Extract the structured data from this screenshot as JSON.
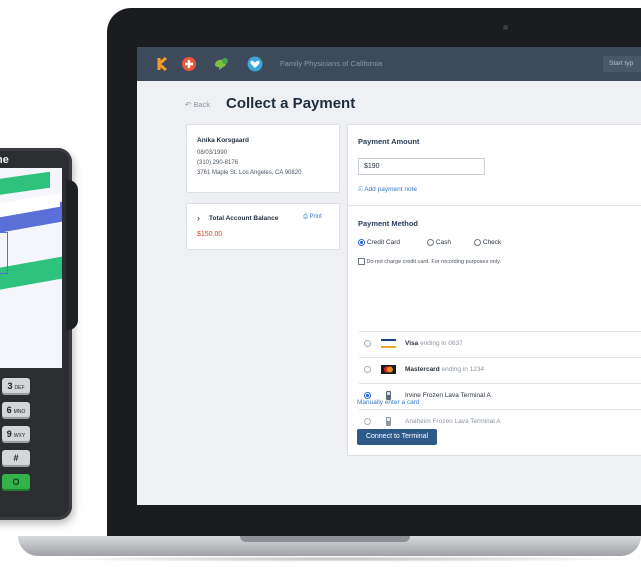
{
  "terminal": {
    "brand": "ne",
    "keys": [
      {
        "num": "3",
        "sub": "DEF"
      },
      {
        "num": "6",
        "sub": "MNO"
      },
      {
        "num": "9",
        "sub": "WXY"
      },
      {
        "num": "#",
        "sub": ""
      }
    ],
    "ok_key": "O"
  },
  "topbar": {
    "org_name": "Family Physicians of California",
    "search_placeholder": "Start typ"
  },
  "header": {
    "back_label": "Back",
    "title": "Collect  a Payment"
  },
  "patient": {
    "name": "Anika Korsgaard",
    "dob": "08/03/1990",
    "phone": "(310) 290-8176",
    "address": "3761 Maple St. Los Angeles, CA 90820"
  },
  "balance": {
    "label": "Total Account Balance",
    "print_label": "Print",
    "amount": "$150.00"
  },
  "payment": {
    "amount_label": "Payment Amount",
    "amount_value": "$190",
    "note_label": "Add payment note",
    "method_label": "Payment Method",
    "methods": [
      "Credit Card",
      "Cash",
      "Check"
    ],
    "selected_method": "Credit Card",
    "no_charge_label": "Do not charge credit card. For recording purposes only.",
    "cards": [
      {
        "brand": "Visa",
        "detail": "ending in 0637",
        "icon": "visa-icon"
      },
      {
        "brand": "Mastercard",
        "detail": "ending in 1234",
        "icon": "mastercard-icon"
      }
    ],
    "terminals": [
      {
        "name": "Irvine Frozen Lava Terminal A",
        "selected": true
      },
      {
        "name": "Anaheim Frozen Lava Terminal A",
        "selected": false
      }
    ],
    "manual_link": "Manually enter a card",
    "connect_button": "Connect to Terminal"
  },
  "colors": {
    "topbar": "#3d4a5c",
    "accent": "#3a78c9",
    "balance": "#d9472b",
    "button": "#2e5a8a"
  }
}
